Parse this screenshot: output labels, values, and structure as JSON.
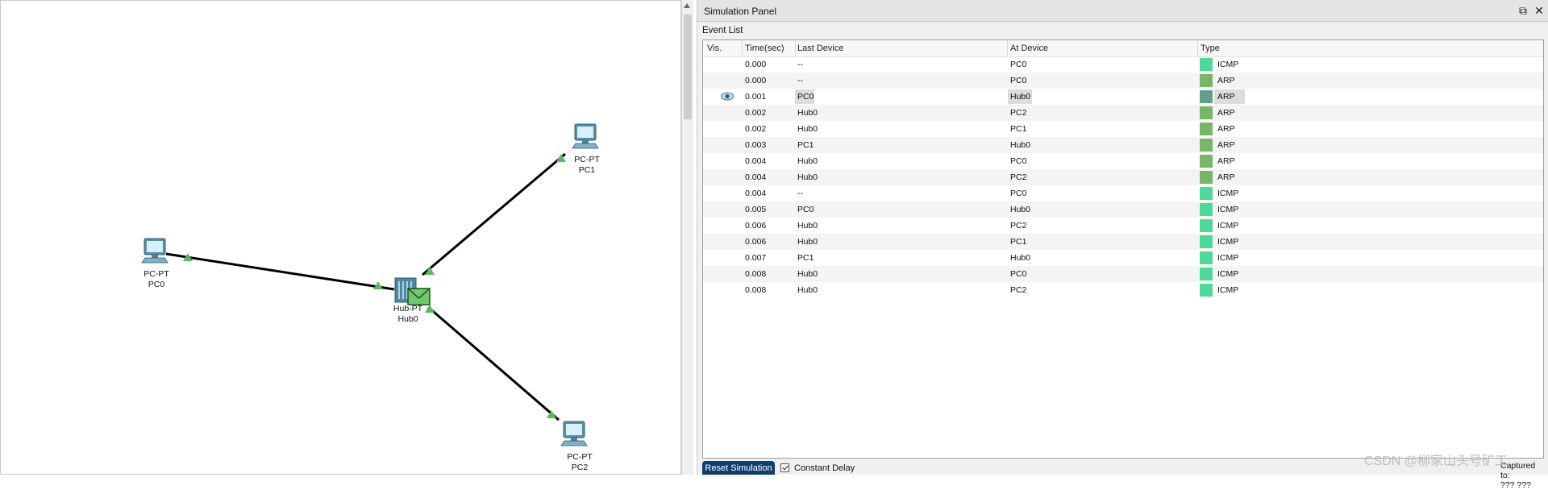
{
  "panel": {
    "title": "Simulation Panel",
    "restore_symbol": "⧉",
    "close_symbol": "✕"
  },
  "event_list": {
    "label": "Event List",
    "columns": {
      "vis": "Vis.",
      "time": "Time(sec)",
      "last_device": "Last Device",
      "at_device": "At Device",
      "type": "Type"
    },
    "rows": [
      {
        "time": "0.000",
        "last": "--",
        "at": "PC0",
        "type": "ICMP",
        "color": "#4ed99b"
      },
      {
        "time": "0.000",
        "last": "--",
        "at": "PC0",
        "type": "ARP",
        "color": "#76b664"
      },
      {
        "time": "0.001",
        "last": "PC0",
        "at": "Hub0",
        "type": "ARP",
        "color": "#5fa08a",
        "selected": true
      },
      {
        "time": "0.002",
        "last": "Hub0",
        "at": "PC2",
        "type": "ARP",
        "color": "#76b664"
      },
      {
        "time": "0.002",
        "last": "Hub0",
        "at": "PC1",
        "type": "ARP",
        "color": "#76b664"
      },
      {
        "time": "0.003",
        "last": "PC1",
        "at": "Hub0",
        "type": "ARP",
        "color": "#76b664"
      },
      {
        "time": "0.004",
        "last": "Hub0",
        "at": "PC0",
        "type": "ARP",
        "color": "#76b664"
      },
      {
        "time": "0.004",
        "last": "Hub0",
        "at": "PC2",
        "type": "ARP",
        "color": "#76b664"
      },
      {
        "time": "0.004",
        "last": "--",
        "at": "PC0",
        "type": "ICMP",
        "color": "#4ed99b"
      },
      {
        "time": "0.005",
        "last": "PC0",
        "at": "Hub0",
        "type": "ICMP",
        "color": "#4ed99b"
      },
      {
        "time": "0.006",
        "last": "Hub0",
        "at": "PC2",
        "type": "ICMP",
        "color": "#4ed99b"
      },
      {
        "time": "0.006",
        "last": "Hub0",
        "at": "PC1",
        "type": "ICMP",
        "color": "#4ed99b"
      },
      {
        "time": "0.007",
        "last": "PC1",
        "at": "Hub0",
        "type": "ICMP",
        "color": "#4ed99b"
      },
      {
        "time": "0.008",
        "last": "Hub0",
        "at": "PC0",
        "type": "ICMP",
        "color": "#4ed99b"
      },
      {
        "time": "0.008",
        "last": "Hub0",
        "at": "PC2",
        "type": "ICMP",
        "color": "#4ed99b"
      }
    ]
  },
  "controls": {
    "reset_label": "Reset Simulation",
    "constant_delay_label": "Constant Delay",
    "constant_delay_checked": true,
    "captured_label": "Captured to:",
    "captured_value": "???  ???"
  },
  "topology": {
    "pc0": {
      "model": "PC-PT",
      "name": "PC0"
    },
    "pc1": {
      "model": "PC-PT",
      "name": "PC1"
    },
    "pc2": {
      "model": "PC-PT",
      "name": "PC2"
    },
    "hub0": {
      "model": "Hub-PT",
      "name": "Hub0"
    }
  },
  "watermark": "CSDN @柳家山头号矿工",
  "colors": {
    "link_up": "#5cb85c",
    "selected_row_bg": "#dcdcdc",
    "reset_button": "#0f3f6e"
  }
}
